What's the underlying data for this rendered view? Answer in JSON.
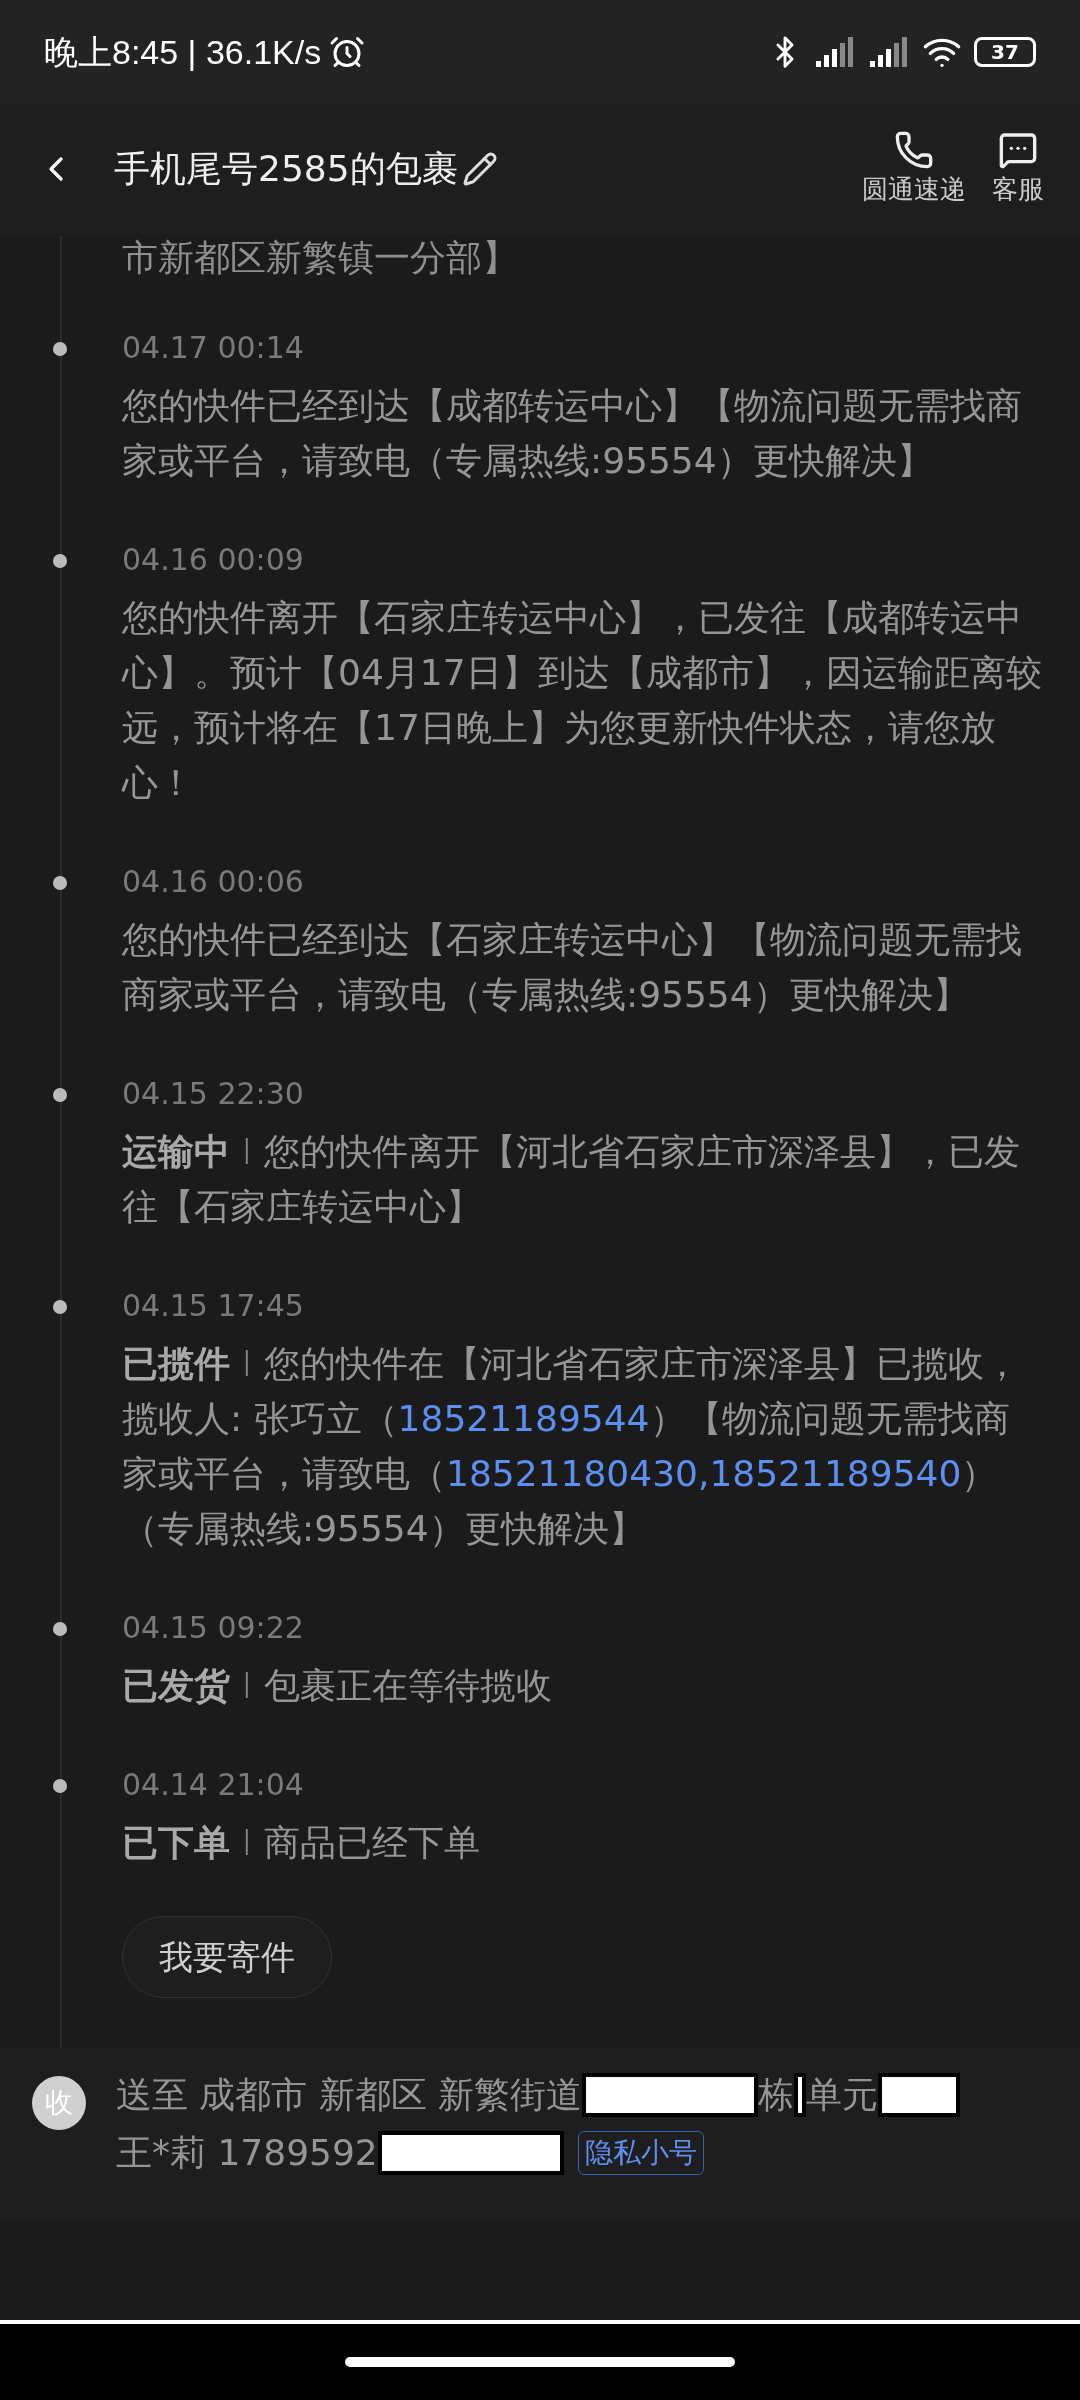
{
  "status_bar": {
    "time": "晚上8:45 | 36.1K/s",
    "battery": "37"
  },
  "header": {
    "title": "手机尾号2585的包裹",
    "actions": [
      {
        "kind": "phone",
        "label": "圆通速递"
      },
      {
        "kind": "chat",
        "label": "客服"
      }
    ]
  },
  "timeline": {
    "partial_text": "市新都区新繁镇一分部】",
    "events": [
      {
        "time": "04.17 00:14",
        "segments": [
          {
            "kind": "text",
            "text": "您的快件已经到达【成都转运中心】【物流问题无需找商家或平台，请致电（专属热线:95554）更快解决】"
          }
        ]
      },
      {
        "time": "04.16 00:09",
        "segments": [
          {
            "kind": "text",
            "text": "您的快件离开【石家庄转运中心】，已发往【成都转运中心】。预计【04月17日】到达【成都市】，因运输距离较远，预计将在【17日晚上】为您更新快件状态，请您放心！"
          }
        ]
      },
      {
        "time": "04.16 00:06",
        "segments": [
          {
            "kind": "text",
            "text": "您的快件已经到达【石家庄转运中心】【物流问题无需找商家或平台，请致电（专属热线:95554）更快解决】"
          }
        ]
      },
      {
        "time": "04.15 22:30",
        "status": "运输中",
        "separator": "I",
        "segments": [
          {
            "kind": "text",
            "text": "您的快件离开【河北省石家庄市深泽县】，已发往【石家庄转运中心】"
          }
        ]
      },
      {
        "time": "04.15 17:45",
        "status": "已揽件",
        "separator": "I",
        "segments": [
          {
            "kind": "text",
            "text": "您的快件在【河北省石家庄市深泽县】已揽收，揽收人: 张巧立（"
          },
          {
            "kind": "link",
            "text": "18521189544"
          },
          {
            "kind": "text",
            "text": "）【物流问题无需找商家或平台，请致电（"
          },
          {
            "kind": "link",
            "text": "18521180430,18521189540"
          },
          {
            "kind": "text",
            "text": "）（专属热线:95554）更快解决】"
          }
        ]
      },
      {
        "time": "04.15 09:22",
        "status": "已发货",
        "separator": "I",
        "segments": [
          {
            "kind": "text",
            "text": "包裹正在等待揽收"
          }
        ]
      },
      {
        "time": "04.14 21:04",
        "status": "已下单",
        "separator": "I",
        "segments": [
          {
            "kind": "text",
            "text": "商品已经下单"
          }
        ]
      }
    ],
    "button": "我要寄件"
  },
  "delivery": {
    "badge": "收",
    "address_parts": [
      {
        "kind": "text",
        "text": "送至 成都市 新都区 新繁街道"
      },
      {
        "kind": "redacted"
      },
      {
        "kind": "text",
        "text": "栋"
      },
      {
        "kind": "redacted"
      },
      {
        "kind": "text",
        "text": "单元"
      },
      {
        "kind": "redacted"
      }
    ],
    "recipient_parts": [
      {
        "kind": "text",
        "text": "王*莉 1789592"
      },
      {
        "kind": "redacted"
      }
    ],
    "tag": "隐私小号"
  }
}
